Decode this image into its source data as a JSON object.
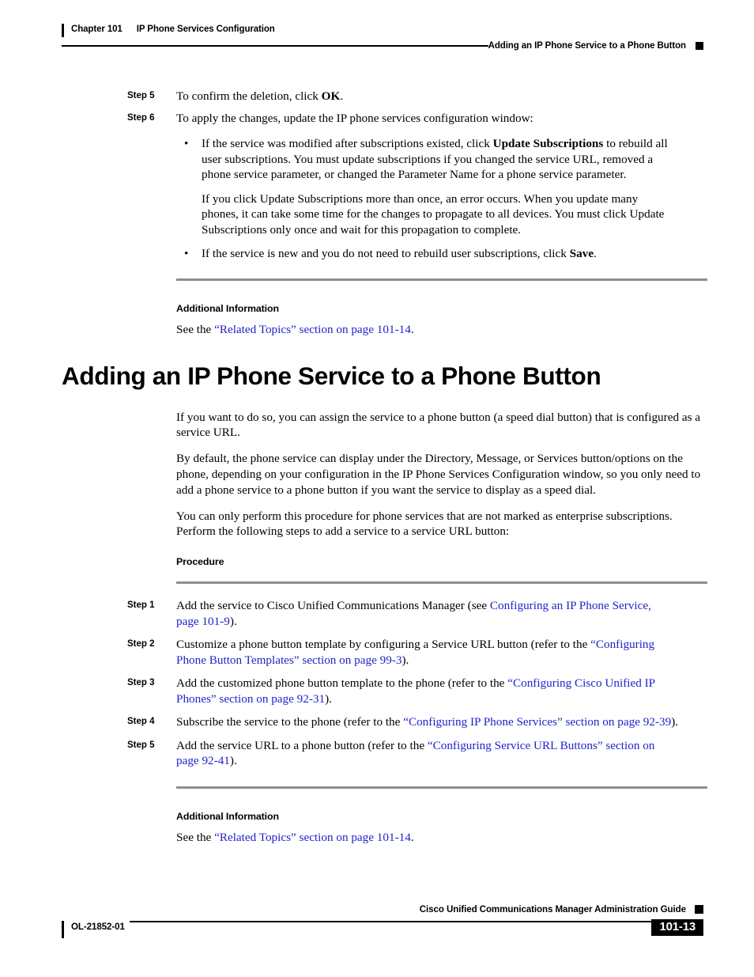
{
  "header": {
    "chapter": "Chapter 101",
    "chapter_title": "IP Phone Services Configuration",
    "section": "Adding an IP Phone Service to a Phone Button"
  },
  "top_steps": [
    {
      "label": "Step 5",
      "text_before": "To confirm the deletion, click ",
      "bold": "OK",
      "text_after": "."
    },
    {
      "label": "Step 6",
      "text": "To apply the changes, update the IP phone services configuration window:"
    }
  ],
  "bullets": [
    {
      "part1": "If the service was modified after subscriptions existed, click ",
      "bold": "Update Subscriptions",
      "part2": " to rebuild all user subscriptions. You must update subscriptions if you changed the service URL, removed a phone service parameter, or changed the Parameter Name for a phone service parameter.",
      "para2": "If you click Update Subscriptions more than once, an error occurs. When you update many phones, it can take some time for the changes to propagate to all devices. You must click Update Subscriptions only once and wait for this propagation to complete."
    },
    {
      "part1": "If the service is new and you do not need to rebuild user subscriptions, click ",
      "bold": "Save",
      "part2": "."
    }
  ],
  "additional_info_1": {
    "heading": "Additional Information",
    "see_the": "See the ",
    "link": "“Related Topics” section on page 101-14",
    "period": "."
  },
  "section_heading": "Adding an IP Phone Service to a Phone Button",
  "intro_paragraphs": [
    "If you want to do so, you can assign the service to a phone button (a speed dial button) that is configured as a service URL.",
    "By default, the phone service can display under the Directory, Message, or Services button/options on the phone, depending on your configuration in the IP Phone Services Configuration window, so you only need to add a phone service to a phone button if you want the service to display as a speed dial.",
    "You can only perform this procedure for phone services that are not marked as enterprise subscriptions. Perform the following steps to add a service to a service URL button:"
  ],
  "procedure_heading": "Procedure",
  "procedure_steps": [
    {
      "label": "Step 1",
      "part1": "Add the service to Cisco Unified Communications Manager (see ",
      "link": "Configuring an IP Phone Service, page 101-9",
      "part2": ")."
    },
    {
      "label": "Step 2",
      "part1": "Customize a phone button template by configuring a Service URL button (refer to the ",
      "link": "“Configuring Phone Button Templates” section on page 99-3",
      "part2": ")."
    },
    {
      "label": "Step 3",
      "part1": "Add the customized phone button template to the phone (refer to the ",
      "link": "“Configuring Cisco Unified IP Phones” section on page 92-31",
      "part2": ")."
    },
    {
      "label": "Step 4",
      "part1": "Subscribe the service to the phone (refer to the ",
      "link": "“Configuring IP Phone Services” section on page 92-39",
      "part2": ")."
    },
    {
      "label": "Step 5",
      "part1": "Add the service URL to a phone button (refer to the ",
      "link": "“Configuring Service URL Buttons” section on page 92-41",
      "part2": ")."
    }
  ],
  "additional_info_2": {
    "heading": "Additional Information",
    "see_the": "See the ",
    "link": "“Related Topics” section on page 101-14",
    "period": "."
  },
  "footer": {
    "guide_title": "Cisco Unified Communications Manager Administration Guide",
    "doc_id": "OL-21852-01",
    "page_number": "101-13"
  },
  "colors": {
    "link": "#2222cc",
    "rule_grey": "#8e8e8e",
    "ink": "#000000"
  }
}
